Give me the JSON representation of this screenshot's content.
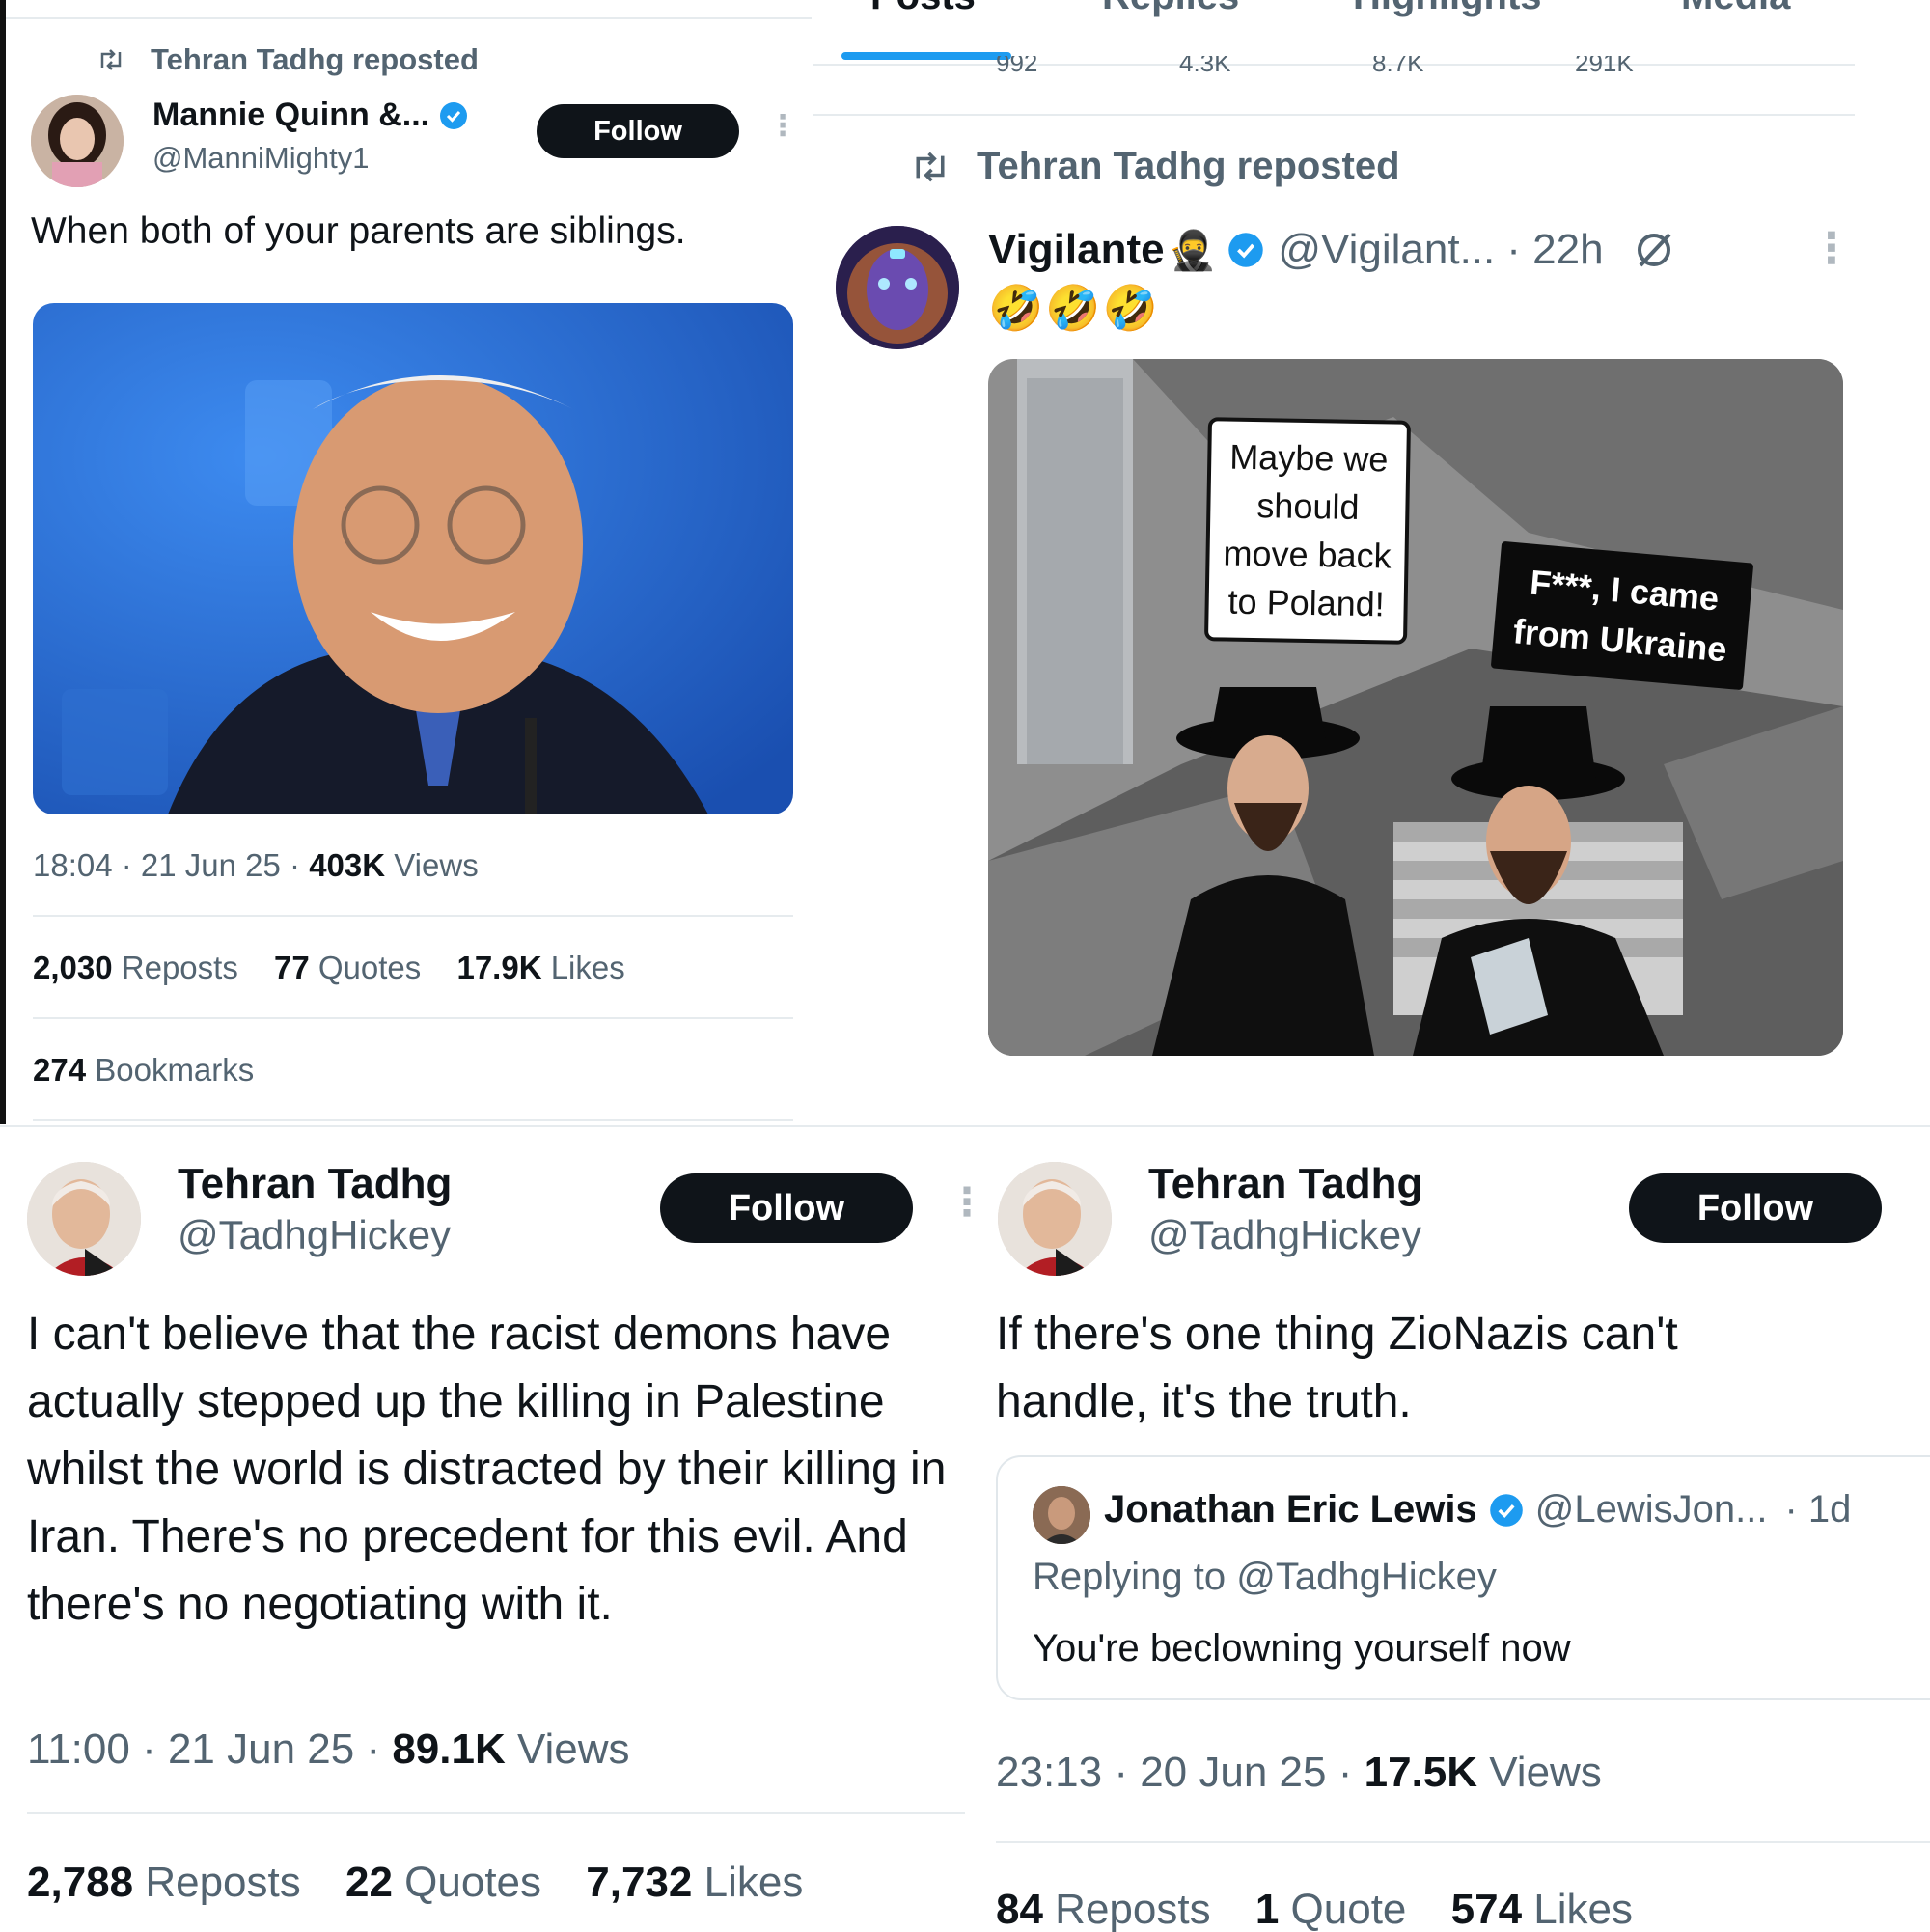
{
  "top_nav": {
    "tabs": [
      {
        "label": "Posts"
      },
      {
        "label": "Replies"
      },
      {
        "label": "Highlights"
      },
      {
        "label": "Media"
      }
    ],
    "prev_stats": {
      "replies": "992",
      "reposts": "4.3K",
      "likes": "8.7K",
      "views": "291K"
    }
  },
  "tweet1": {
    "repost_label": "Tehran Tadhg reposted",
    "author_name": "Mannie Quinn &...",
    "handle": "@ManniMighty1",
    "follow": "Follow",
    "text": "When both of your parents are siblings.",
    "time": "18:04 · 21 Jun 25 · ",
    "views_num": "403K",
    "views_label": " Views",
    "reposts_num": "2,030",
    "reposts_label": " Reposts",
    "quotes_num": "77",
    "quotes_label": " Quotes",
    "likes_num": "17.9K",
    "likes_label": " Likes",
    "bookmarks_num": "274",
    "bookmarks_label": " Bookmarks"
  },
  "tweet2": {
    "repost_label": "Tehran Tadhg reposted",
    "author_name": "Vigilante",
    "author_emoji": "🥷",
    "handle": "@Vigilant...",
    "age": "· 22h",
    "text": "🤣🤣🤣",
    "bubble1": "Maybe we should move back to Poland!",
    "bubble2": "F***, I came from Ukraine"
  },
  "tweet3": {
    "author_name": "Tehran Tadhg",
    "handle": "@TadhgHickey",
    "follow": "Follow",
    "text": "I can't believe that the racist demons have actually stepped up the killing in Palestine whilst the world is distracted by their killing in Iran. There's no precedent for this evil. And there's no negotiating with it.",
    "time": "11:00 · 21 Jun 25 · ",
    "views_num": "89.1K",
    "views_label": " Views",
    "reposts_num": "2,788",
    "reposts_label": " Reposts",
    "quotes_num": "22",
    "quotes_label": " Quotes",
    "likes_num": "7,732",
    "likes_label": " Likes"
  },
  "tweet4": {
    "author_name": "Tehran Tadhg",
    "handle": "@TadhgHickey",
    "follow": "Follow",
    "text": "If there's one thing ZioNazis can't handle, it's the truth.",
    "quoted_name": "Jonathan Eric Lewis",
    "quoted_handle": "@LewisJon...",
    "quoted_age": "· 1d",
    "quoted_reply_to": "Replying to @TadhgHickey",
    "quoted_text": "You're beclowning yourself now",
    "time": "23:13 · 20 Jun 25 · ",
    "views_num": "17.5K",
    "views_label": " Views",
    "reposts_num": "84",
    "reposts_label": " Reposts",
    "quotes_num": "1",
    "quotes_label": " Quote",
    "likes_num": "574",
    "likes_label": " Likes"
  },
  "colors": {
    "text": "#0f1419",
    "muted": "#536471",
    "verified": "#1d9bf0",
    "follow_bg": "#0f1419",
    "divider": "#e6ebee"
  }
}
